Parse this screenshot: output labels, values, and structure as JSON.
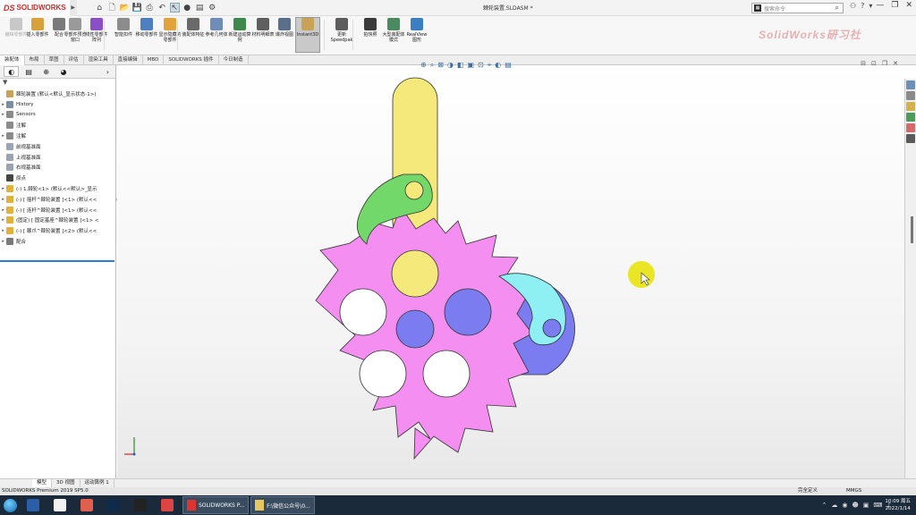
{
  "app": {
    "logo_ds": "DS",
    "logo_name": "SOLIDWORKS",
    "doc_title": "棘轮装置.SLDASM *",
    "search_placeholder": "搜索命令",
    "window_buttons": [
      "—",
      "❐",
      "✕"
    ]
  },
  "ribbon": {
    "items": [
      {
        "label": "编辑零部件",
        "color": "#c8c8c8",
        "disabled": true
      },
      {
        "label": "插入零部件",
        "color": "#d7a23b"
      },
      {
        "label": "配合",
        "color": "#7a7a7a"
      },
      {
        "label": "零部件预览窗口",
        "color": "#9a9a9a"
      },
      {
        "label": "线性零部件阵列",
        "color": "#8a4fc4"
      },
      {
        "label": "智能扣件",
        "color": "#8c8c8c"
      },
      {
        "label": "移动零部件",
        "color": "#4e7fc0"
      },
      {
        "label": "显示隐藏的零部件",
        "color": "#e0a43a"
      },
      {
        "label": "装配体特征",
        "color": "#6a6a6a"
      },
      {
        "label": "参考几何体",
        "color": "#6f8db8"
      },
      {
        "label": "新建运动算例",
        "color": "#3d8a4c"
      },
      {
        "label": "材料明细表",
        "color": "#5f5f5f"
      },
      {
        "label": "爆炸视图",
        "color": "#5b6e8a"
      },
      {
        "label": "Instant3D",
        "color": "#c9a257",
        "active": true
      },
      {
        "label": "更新 Speedpak",
        "color": "#5d5d5d"
      },
      {
        "label": "拍快照",
        "color": "#3a3a3a"
      },
      {
        "label": "大型装配体模式",
        "color": "#4b8b5f"
      },
      {
        "label": "RealView 图形",
        "color": "#3a7fc0"
      }
    ],
    "watermark": "SolidWorks研习社"
  },
  "tabs": [
    "装配体",
    "布局",
    "草图",
    "评估",
    "渲染工具",
    "直接编辑",
    "MBD",
    "SOLIDWORKS 插件",
    "今日制造"
  ],
  "active_tab": "装配体",
  "panel": {
    "tabs": [
      "feature-manager",
      "property-manager",
      "configuration-manager",
      "display-manager"
    ],
    "filter": "▼",
    "tree": [
      {
        "label": "棘轮装置 (默认<默认_显示状态-1>)",
        "toggle": "",
        "color": "#c9a257"
      },
      {
        "label": "History",
        "toggle": "▸",
        "color": "#7a8ea5"
      },
      {
        "label": "Sensors",
        "toggle": "▸",
        "color": "#8b8b8b"
      },
      {
        "label": "注解",
        "toggle": "",
        "color": "#8b8b8b"
      },
      {
        "label": "注解",
        "toggle": "▸",
        "color": "#8b8b8b"
      },
      {
        "label": "前视基准面",
        "toggle": "",
        "color": "#9aa4b2"
      },
      {
        "label": "上视基准面",
        "toggle": "",
        "color": "#9aa4b2"
      },
      {
        "label": "右视基准面",
        "toggle": "",
        "color": "#9aa4b2"
      },
      {
        "label": "原点",
        "toggle": "",
        "color": "#444"
      },
      {
        "label": "(-) 1.棘轮<1> (默认<<默认>_显示",
        "toggle": "▸",
        "color": "#e0b23a"
      },
      {
        "label": "(-) [ 摇杆^棘轮装置 ]<1> (默认<<",
        "toggle": "▸",
        "color": "#e0b23a"
      },
      {
        "label": "(-) [ 连杆^棘轮装置 ]<1> (默认<<",
        "toggle": "▸",
        "color": "#e0b23a"
      },
      {
        "label": "(固定) [ 固定基座^棘轮装置 ]<1> <",
        "toggle": "▸",
        "color": "#e0b23a"
      },
      {
        "label": "(-) [ 棘爪^棘轮装置 ]<2> (默认<<",
        "toggle": "▸",
        "color": "#e0b23a"
      },
      {
        "label": "配合",
        "toggle": "▸",
        "color": "#7a7a7a"
      }
    ]
  },
  "viewport": {
    "view_tools": [
      "⊕",
      "⌕",
      "⊠",
      "◑",
      "◧",
      "▣",
      "⊡",
      "⌖",
      "◐",
      "▤"
    ],
    "window_controls": [
      "⊟",
      "⊡",
      "❐",
      "✕"
    ],
    "colors": {
      "gear": "#f48ef0",
      "rod": "#f4e97a",
      "link_green": "#72d86a",
      "pawl_cyan": "#8ff0f4",
      "base_blue": "#7a7cf0",
      "cursor": "#e8e200"
    }
  },
  "bottom_tabs": [
    "模型",
    "3D 视图",
    "运动算例 1"
  ],
  "status": {
    "left": "SOLIDWORKS Premium 2019 SP5.0",
    "mid": "完全定义",
    "units": "MMGS"
  },
  "taskbar": {
    "apps": [
      {
        "name": "start",
        "color": "#1667b0"
      },
      {
        "name": "app-1",
        "color": "#2a5fa8"
      },
      {
        "name": "app-2",
        "color": "#f2f2f2"
      },
      {
        "name": "app-3",
        "color": "#e06050"
      },
      {
        "name": "photoshop",
        "color": "#0f2b4a"
      },
      {
        "name": "davinci",
        "color": "#222"
      },
      {
        "name": "app-6",
        "color": "#d44"
      }
    ],
    "windows": [
      "SOLIDWORKS P...",
      "F:\\微信公众号\\0..."
    ],
    "clock_time": "10:09 周五",
    "clock_date": "2022/1/14"
  }
}
